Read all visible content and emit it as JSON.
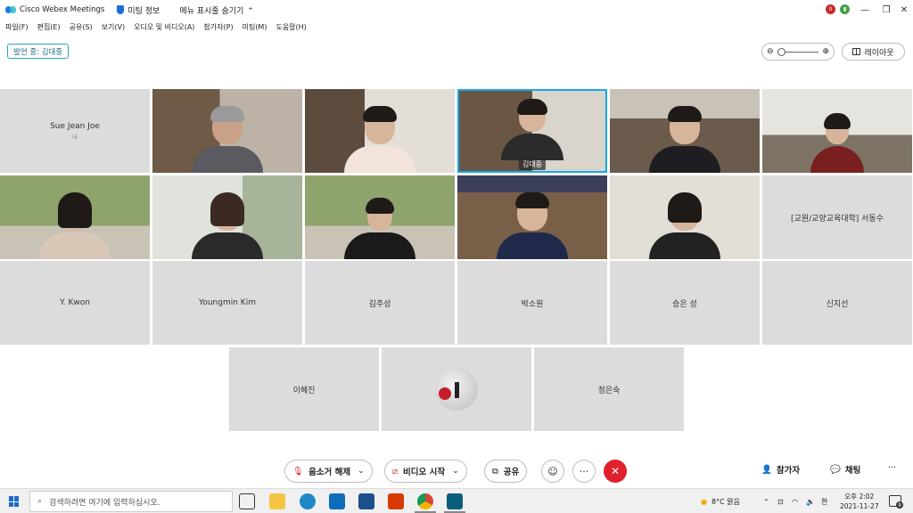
{
  "window": {
    "app_title": "Cisco Webex Meetings",
    "meeting_info": "미팅 정보",
    "hide_menu": "메뉴 표시줄 숨기기",
    "rec_badge": "0",
    "colors": {
      "accent": "#29a5c9",
      "end_call": "#e0202c",
      "active_speaker": "#1aa7e6"
    }
  },
  "menu": [
    "파일(F)",
    "편집(E)",
    "공유(S)",
    "보기(V)",
    "오디오 및 비디오(A)",
    "참가자(P)",
    "미팅(M)",
    "도움말(H)"
  ],
  "speaking_chip": "발언 중: 김대중",
  "layout_label": "레이아웃",
  "tiles": {
    "sue": {
      "name": "Sue Jean Joe",
      "sub": "나"
    },
    "active_speaker": "김대중",
    "seo": "[교원/교양교육대학] 서동수",
    "kwon": "Y. Kwon",
    "youngmin": "Youngmin Kim",
    "kimjusung": "김주성",
    "parksowon": "박소원",
    "seungeun": "승은 성",
    "shinjiseon": "신지선",
    "leehyejin": "이혜진",
    "jungeunsook": "정은숙"
  },
  "controls": {
    "unmute": "음소거 해제",
    "start_video": "비디오 시작",
    "share": "공유",
    "participants": "참가자",
    "chat": "채팅"
  },
  "taskbar": {
    "search_placeholder": "검색하려면 여기에 입력하십시오.",
    "weather": "8°C 맑음",
    "ime": "한",
    "time": "오후 2:02",
    "date": "2021-11-27",
    "notifications": "9"
  }
}
